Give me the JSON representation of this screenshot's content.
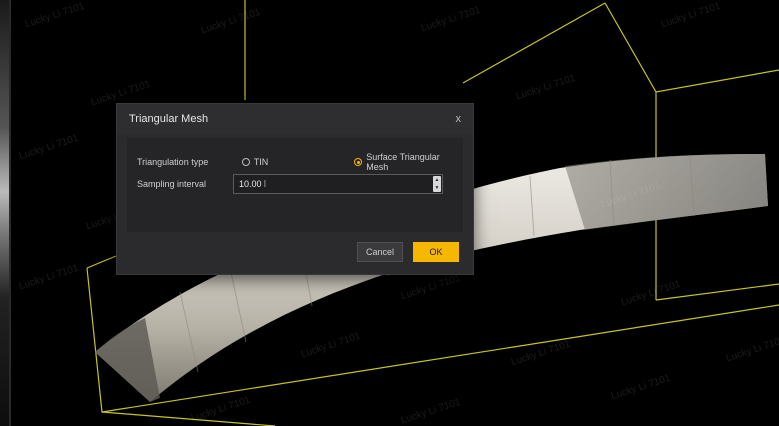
{
  "dialog": {
    "title": "Triangular Mesh",
    "close_label": "x",
    "triangulation": {
      "label": "Triangulation type",
      "options": [
        {
          "label": "TIN",
          "checked": false
        },
        {
          "label": "Surface Triangular Mesh",
          "checked": true
        }
      ]
    },
    "sampling": {
      "label": "Sampling interval",
      "value": "10.00"
    },
    "buttons": {
      "cancel": "Cancel",
      "ok": "OK"
    }
  },
  "watermark_text": "Lucky Li 7101",
  "colors": {
    "accent": "#f5b700",
    "bounding_box": "#c9c422",
    "background": "#000000",
    "dialog_bg": "#2b2b2d"
  }
}
